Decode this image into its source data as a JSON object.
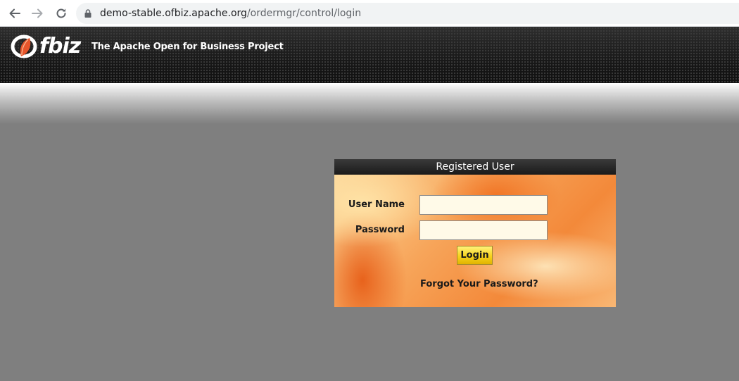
{
  "browser": {
    "url_host": "demo-stable.ofbiz.apache.org",
    "url_path": "/ordermgr/control/login",
    "icons": [
      "back-arrow-icon",
      "forward-arrow-icon",
      "reload-icon",
      "lock-icon"
    ]
  },
  "header": {
    "logo_text": "fbiz",
    "title": "The Apache Open for Business Project",
    "colors": {
      "background": "#1c1c1c",
      "logo_leaf": "#e8552b"
    }
  },
  "login": {
    "title": "Registered User",
    "username_label": "User Name",
    "password_label": "Password",
    "username_value": "",
    "password_value": "",
    "login_button": "Login",
    "forgot_link": "Forgot Your Password?",
    "colors": {
      "title_bar": "#1a1a1a",
      "input_bg": "#fffae8",
      "button": "#f7d21c"
    }
  },
  "page": {
    "background": "#7f7f7f"
  }
}
